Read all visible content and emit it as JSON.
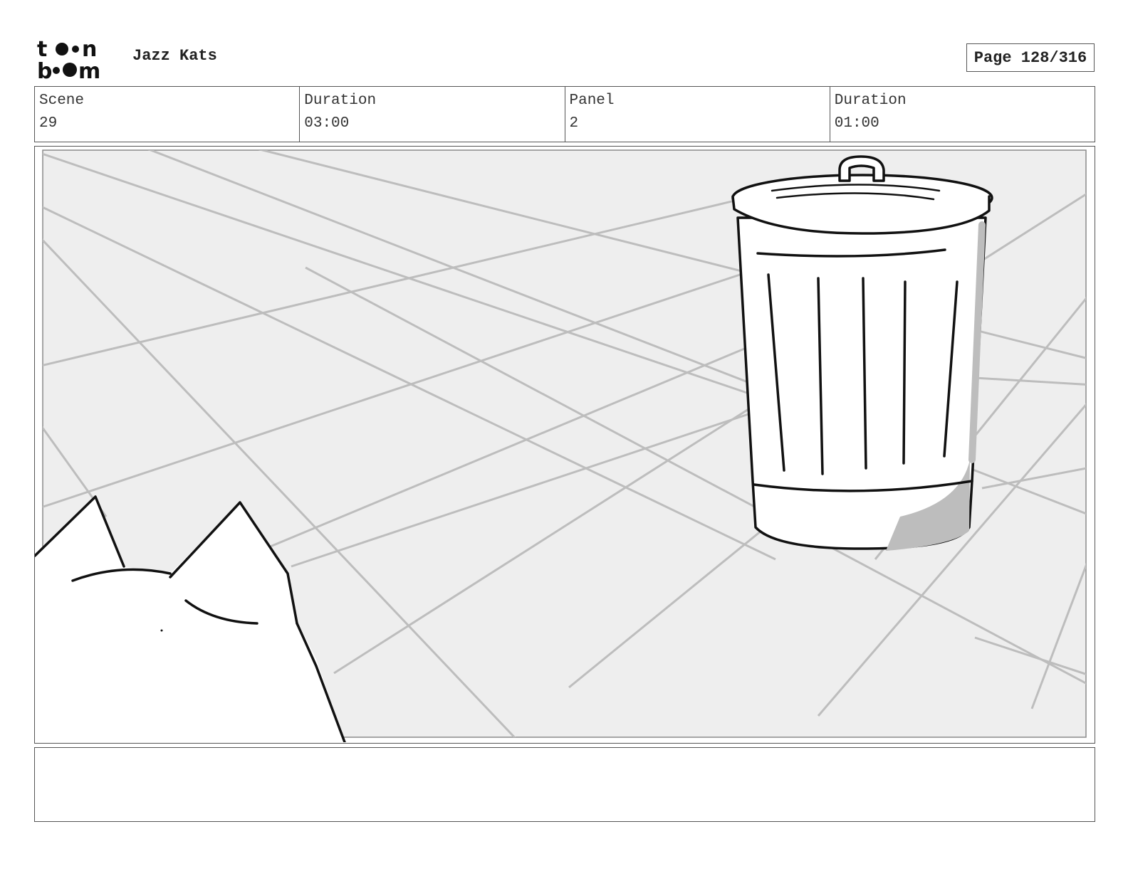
{
  "header": {
    "logo_top": "to•n",
    "logo_bottom": "b••m",
    "project_title": "Jazz Kats",
    "page_label": "Page 128/316"
  },
  "info": {
    "scene_label": "Scene",
    "scene_value": "29",
    "scene_duration_label": "Duration",
    "scene_duration_value": "03:00",
    "panel_label": "Panel",
    "panel_value": "2",
    "panel_duration_label": "Duration",
    "panel_duration_value": "01:00"
  },
  "notes": {
    "text": ""
  },
  "colors": {
    "background": "#ffffff",
    "floor": "#eeeeee",
    "grid": "#bdbdbd",
    "ink": "#111111"
  }
}
